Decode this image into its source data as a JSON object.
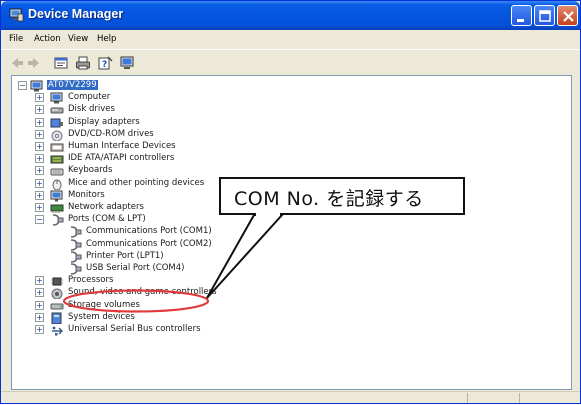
{
  "window": {
    "title": "Device Manager",
    "icons": {
      "app": "device-manager-icon",
      "minimize": "minimize-icon",
      "maximize": "maximize-icon",
      "close": "close-icon"
    }
  },
  "menu": [
    "File",
    "Action",
    "View",
    "Help"
  ],
  "toolbar": [
    "back-arrow-icon",
    "forward-arrow-icon",
    "properties-icon",
    "print-icon",
    "help-icon",
    "computer-icon"
  ],
  "tree": {
    "root": "AT07V2299",
    "items": [
      {
        "label": "Computer",
        "icon": "computer-icon"
      },
      {
        "label": "Disk drives",
        "icon": "disk-drive-icon"
      },
      {
        "label": "Display adapters",
        "icon": "display-adapter-icon"
      },
      {
        "label": "DVD/CD-ROM drives",
        "icon": "dvd-drive-icon"
      },
      {
        "label": "Human Interface Devices",
        "icon": "hid-icon"
      },
      {
        "label": "IDE ATA/ATAPI controllers",
        "icon": "ide-controller-icon"
      },
      {
        "label": "Keyboards",
        "icon": "keyboard-icon"
      },
      {
        "label": "Mice and other pointing devices",
        "icon": "mouse-icon"
      },
      {
        "label": "Monitors",
        "icon": "monitor-icon"
      },
      {
        "label": "Network adapters",
        "icon": "network-adapter-icon"
      },
      {
        "label": "Ports (COM & LPT)",
        "icon": "port-icon"
      },
      {
        "label": "Communications Port (COM1)",
        "icon": "port-icon"
      },
      {
        "label": "Communications Port (COM2)",
        "icon": "port-icon"
      },
      {
        "label": "Printer Port (LPT1)",
        "icon": "port-icon"
      },
      {
        "label": "USB Serial Port (COM4)",
        "icon": "port-icon"
      },
      {
        "label": "Processors",
        "icon": "processor-icon"
      },
      {
        "label": "Sound, video and game controllers",
        "icon": "sound-icon"
      },
      {
        "label": "Storage volumes",
        "icon": "storage-icon"
      },
      {
        "label": "System devices",
        "icon": "system-device-icon"
      },
      {
        "label": "Universal Serial Bus controllers",
        "icon": "usb-icon"
      }
    ]
  },
  "annotation": {
    "callout_text": "COM No. を記録する",
    "highlight_color": "#e23a3a"
  }
}
